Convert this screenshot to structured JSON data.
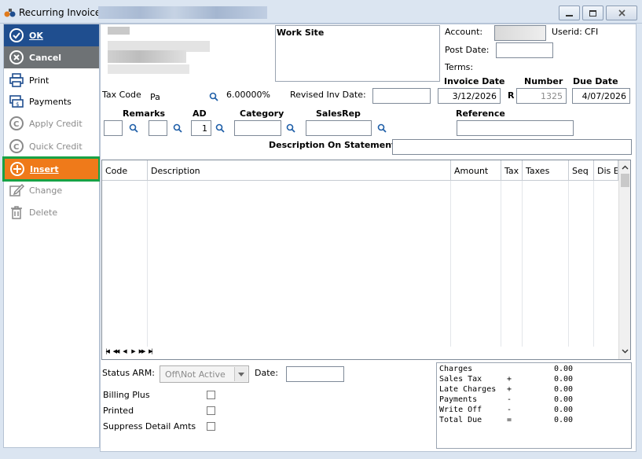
{
  "window": {
    "title": "Recurring Invoice -"
  },
  "sidebar": {
    "items": [
      {
        "label": "OK",
        "icon": "check-circle-icon"
      },
      {
        "label": "Cancel",
        "icon": "x-circle-icon"
      },
      {
        "label": "Print",
        "icon": "printer-icon"
      },
      {
        "label": "Payments",
        "icon": "payments-icon"
      },
      {
        "label": "Apply Credit",
        "icon": "apply-credit-icon"
      },
      {
        "label": "Quick Credit",
        "icon": "quick-credit-icon"
      },
      {
        "label": "Insert",
        "icon": "plus-circle-icon"
      },
      {
        "label": "Change",
        "icon": "edit-icon"
      },
      {
        "label": "Delete",
        "icon": "trash-icon"
      }
    ]
  },
  "form": {
    "work_site_label": "Work Site",
    "account_label": "Account:",
    "userid_label": "Userid:",
    "userid_value": "CFI",
    "post_date_label": "Post Date:",
    "terms_label": "Terms:",
    "invoice_date_label": "Invoice Date",
    "number_label": "Number",
    "due_date_label": "Due Date",
    "invoice_date_value": "3/12/2026",
    "number_prefix": "R",
    "number_value": "1325",
    "due_date_value": "4/07/2026",
    "tax_code_label": "Tax Code",
    "tax_code_value": "Pa",
    "tax_rate": "6.00000%",
    "revised_inv_date_label": "Revised Inv Date:",
    "remarks_label": "Remarks",
    "ad_label": "AD",
    "ad_value": "1",
    "category_label": "Category",
    "salesrep_label": "SalesRep",
    "reference_label": "Reference",
    "description_on_statement_label": "Description On Statement"
  },
  "grid": {
    "columns": [
      "Code",
      "Description",
      "Amount",
      "Tax",
      "Taxes",
      "Seq",
      "Dis E"
    ],
    "rows": []
  },
  "status": {
    "status_arm_label": "Status ARM:",
    "status_arm_value": "Off\\Not Active",
    "date_label": "Date:",
    "billing_plus_label": "Billing Plus",
    "printed_label": "Printed",
    "suppress_label": "Suppress Detail Amts"
  },
  "totals": [
    {
      "label": "Charges",
      "sign": "",
      "value": "0.00"
    },
    {
      "label": "Sales Tax",
      "sign": "+",
      "value": "0.00"
    },
    {
      "label": "Late Charges",
      "sign": "+",
      "value": "0.00"
    },
    {
      "label": "Payments",
      "sign": "-",
      "value": "0.00"
    },
    {
      "label": "Write Off",
      "sign": "-",
      "value": "0.00"
    },
    {
      "label": "Total Due",
      "sign": "=",
      "value": "0.00"
    }
  ],
  "colors": {
    "ok": "#1f4e8f",
    "cancel": "#6e7275",
    "insert": "#ef7a1a",
    "insert_border": "#18a246",
    "search_icon": "#1f5fa8"
  }
}
